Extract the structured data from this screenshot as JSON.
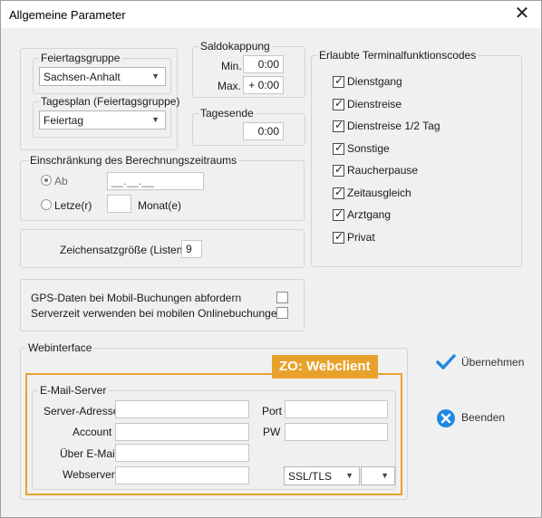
{
  "window": {
    "title": "Allgemeine Parameter"
  },
  "feiertagsgruppe": {
    "legend": "Feiertagsgruppe",
    "value": "Sachsen-Anhalt"
  },
  "tagesplan": {
    "legend": "Tagesplan (Feiertagsgruppe)",
    "value": "Feiertag"
  },
  "saldokappung": {
    "legend": "Saldokappung",
    "min_label": "Min.",
    "min_value": "0:00",
    "max_label": "Max.",
    "max_value": "+ 0:00"
  },
  "tagesende": {
    "legend": "Tagesende",
    "value": "0:00"
  },
  "terminal": {
    "legend": "Erlaubte Terminalfunktionscodes",
    "items": [
      {
        "label": "Dienstgang",
        "checked": true
      },
      {
        "label": "Dienstreise",
        "checked": true
      },
      {
        "label": "Dienstreise 1/2 Tag",
        "checked": true
      },
      {
        "label": "Sonstige",
        "checked": true
      },
      {
        "label": "Raucherpause",
        "checked": true
      },
      {
        "label": "Zeitausgleich",
        "checked": true
      },
      {
        "label": "Arztgang",
        "checked": true
      },
      {
        "label": "Privat",
        "checked": true
      }
    ]
  },
  "einschraenkung": {
    "legend": "Einschränkung des Berechnungszeitraums",
    "ab_label": "Ab",
    "ab_value": "__.__.__",
    "letzte_label": "Letze(r)",
    "letzte_value": "",
    "monat_label": "Monat(e)"
  },
  "zeichensatz": {
    "label": "Zeichensatzgröße (Listen)",
    "value": "9"
  },
  "options": {
    "gps_label": "GPS-Daten bei Mobil-Buchungen abfordern",
    "serverzeit_label": "Serverzeit verwenden bei mobilen Onlinebuchungen"
  },
  "webinterface": {
    "legend": "Webinterface"
  },
  "highlight": {
    "label": "ZO: Webclient",
    "color": "#e8a22c"
  },
  "email": {
    "legend": "E-Mail-Server",
    "server_label": "Server-Adresse",
    "server_value": "",
    "port_label": "Port",
    "port_value": "",
    "account_label": "Account",
    "account_value": "",
    "pw_label": "PW",
    "pw_value": "",
    "ueber_label": "Über E-Mail",
    "ueber_value": "",
    "webserver_label": "Webserver",
    "webserver_value": "",
    "security_value": "SSL/TLS",
    "second_value": ""
  },
  "actions": {
    "uebernehmen_label": "Übernehmen",
    "beenden_label": "Beenden",
    "accent": "#1e88e5"
  }
}
